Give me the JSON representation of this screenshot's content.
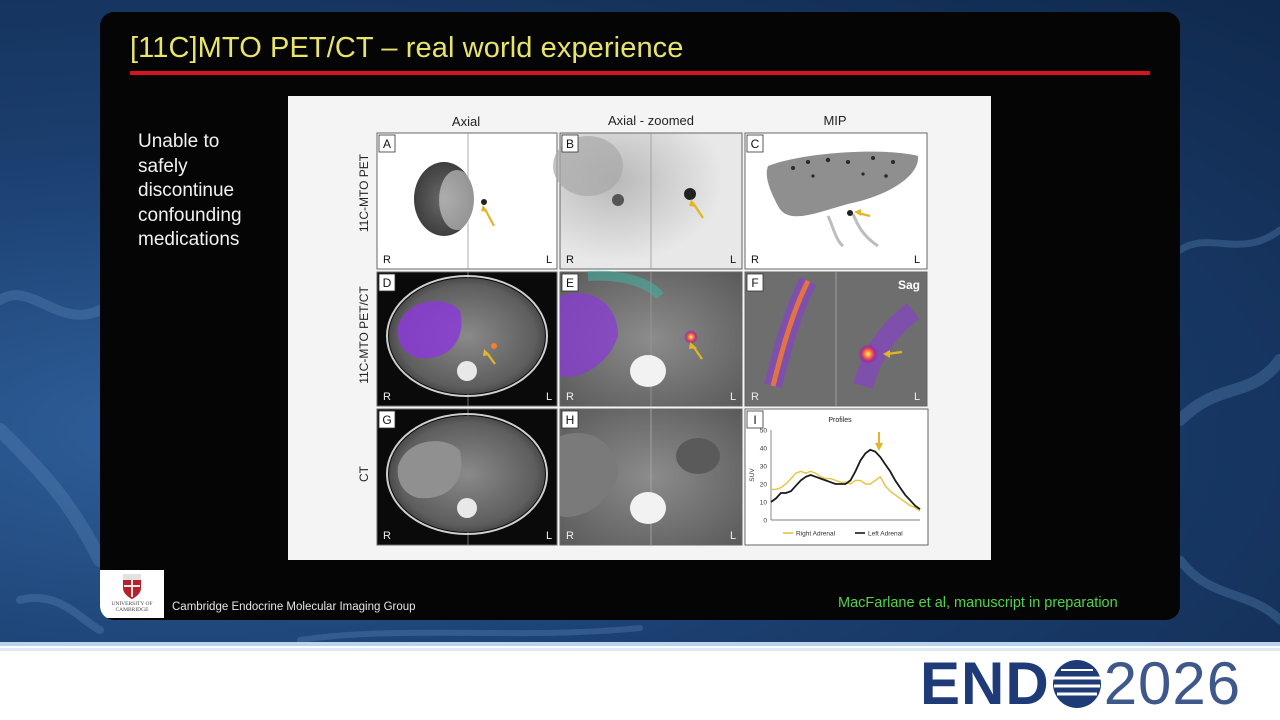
{
  "slide": {
    "title": "[11C]MTO PET/CT – real world experience",
    "bullet_lines": [
      "Unable to",
      "safely",
      "discontinue",
      "confounding",
      "medications"
    ],
    "group_label": "Cambridge Endocrine Molecular Imaging Group",
    "citation": "MacFarlane et al, manuscript in preparation",
    "logo_text_1": "UNIVERSITY OF",
    "logo_text_2": "CAMBRIDGE"
  },
  "figure": {
    "columns": [
      "Axial",
      "Axial - zoomed",
      "MIP"
    ],
    "rows": [
      "11C-MTO PET",
      "11C-MTO PET/CT",
      "CT"
    ],
    "panels": [
      "A",
      "B",
      "C",
      "D",
      "E",
      "F",
      "G",
      "H",
      "I"
    ],
    "orientation_right": "R",
    "orientation_left": "L",
    "sag_label": "Sag"
  },
  "footer": {
    "brand_bold": "END",
    "brand_thin": "2026"
  },
  "colors": {
    "title": "#e8e46a",
    "rule": "#d6141c",
    "citation": "#53d34b",
    "brand": "#1e3b78",
    "arrow": "#e4b625"
  },
  "chart_data": {
    "type": "line",
    "title": "Profiles",
    "xlabel": "",
    "ylabel": "SUV",
    "ylim": [
      0,
      50
    ],
    "yticks": [
      0,
      10,
      20,
      30,
      40,
      50
    ],
    "grid": false,
    "legend": "bottom",
    "x": [
      0,
      1,
      2,
      3,
      4,
      5,
      6,
      7,
      8,
      9,
      10,
      11,
      12,
      13,
      14,
      15,
      16,
      17,
      18,
      19,
      20,
      21,
      22,
      23,
      24,
      25,
      26,
      27,
      28,
      29,
      30
    ],
    "series": [
      {
        "name": "Right Adrenal",
        "color": "#e7c43a",
        "values": [
          17,
          17,
          18,
          20,
          23,
          26,
          27,
          26,
          27,
          26,
          24,
          23,
          23,
          22,
          21,
          21,
          20,
          22,
          22,
          20,
          20,
          22,
          24,
          19,
          16,
          14,
          12,
          10,
          8,
          7,
          5
        ]
      },
      {
        "name": "Left Adrenal",
        "color": "#1a1a1a",
        "values": [
          10,
          12,
          15,
          15,
          16,
          19,
          22,
          24,
          25,
          24,
          23,
          22,
          21,
          20,
          20,
          20,
          22,
          27,
          33,
          37,
          39,
          38,
          35,
          31,
          27,
          22,
          18,
          14,
          11,
          8,
          6
        ]
      }
    ]
  }
}
